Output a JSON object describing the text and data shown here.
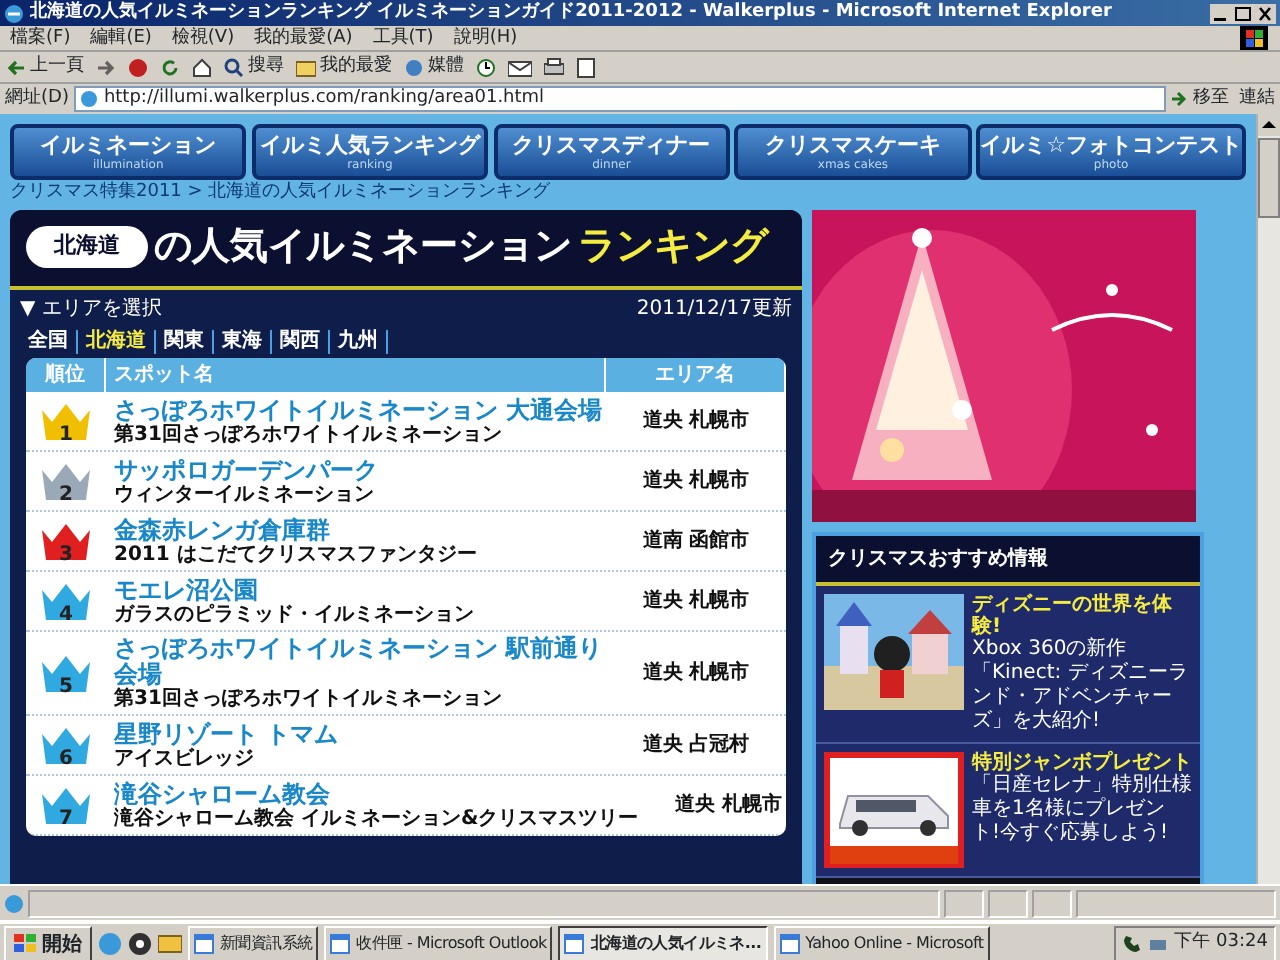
{
  "window": {
    "title": "北海道の人気イルミネーションランキング イルミネーションガイド2011-2012 - Walkerplus - Microsoft Internet Explorer"
  },
  "menu": [
    "檔案(F)",
    "編輯(E)",
    "檢視(V)",
    "我的最愛(A)",
    "工具(T)",
    "說明(H)"
  ],
  "toolbar": [
    "上一頁",
    "搜尋",
    "我的最愛",
    "媒體"
  ],
  "address": {
    "label": "網址(D)",
    "value": "http://illumi.walkerplus.com/ranking/area01.html",
    "go": "移至",
    "links": "連結"
  },
  "nav": [
    {
      "label": "イルミネーション",
      "sub": "illumination"
    },
    {
      "label": "イルミ人気ランキング",
      "sub": "ranking"
    },
    {
      "label": "クリスマスディナー",
      "sub": "dinner"
    },
    {
      "label": "クリスマスケーキ",
      "sub": "xmas cakes"
    },
    {
      "label": "イルミ☆フォトコンテスト",
      "sub": "photo"
    }
  ],
  "breadcrumb": "クリスマス特集2011 > 北海道の人気イルミネーションランキング",
  "ranking": {
    "region": "北海道",
    "title": "の人気イルミネーション",
    "title_accent": "ランキング",
    "area_label": "▼ エリアを選択",
    "updated": "2011/12/17更新",
    "areas": [
      {
        "label": "全国",
        "selected": false
      },
      {
        "label": "北海道",
        "selected": true
      },
      {
        "label": "関東",
        "selected": false
      },
      {
        "label": "東海",
        "selected": false
      },
      {
        "label": "関西",
        "selected": false
      },
      {
        "label": "九州",
        "selected": false
      }
    ],
    "columns": [
      "順位",
      "スポット名",
      "エリア名"
    ],
    "rows": [
      {
        "rank": "1",
        "color": "#f0c000",
        "name": "さっぽろホワイトイルミネーション 大通会場",
        "event": "第31回さっぽろホワイトイルミネーション",
        "area": "道央 札幌市"
      },
      {
        "rank": "2",
        "color": "#9aa8b8",
        "name": "サッポロガーデンパーク",
        "event": "ウィンターイルミネーション",
        "area": "道央 札幌市"
      },
      {
        "rank": "3",
        "color": "#e02020",
        "name": "金森赤レンガ倉庫群",
        "event": "2011 はこだてクリスマスファンタジー",
        "area": "道南 函館市"
      },
      {
        "rank": "4",
        "color": "#30a8e0",
        "name": "モエレ沼公園",
        "event": "ガラスのピラミッド・イルミネーション",
        "area": "道央 札幌市"
      },
      {
        "rank": "5",
        "color": "#30a8e0",
        "name": "さっぽろホワイトイルミネーション 駅前通り会場",
        "event": "第31回さっぽろホワイトイルミネーション",
        "area": "道央 札幌市"
      },
      {
        "rank": "6",
        "color": "#30a8e0",
        "name": "星野リゾート トマム",
        "event": "アイスビレッジ",
        "area": "道央 占冠村"
      },
      {
        "rank": "7",
        "color": "#30a8e0",
        "name": "滝谷シャローム教会",
        "event": "滝谷シャローム教会 イルミネーション&クリスマスツリー",
        "area": "道央 札幌市"
      }
    ]
  },
  "recommend": {
    "title": "クリスマスおすすめ情報",
    "items": [
      {
        "kind": "park",
        "headline": "ディズニーの世界を体験!",
        "text": "Xbox 360の新作「Kinect: ディズニーランド・アドベンチャーズ」を大紹介!"
      },
      {
        "kind": "car",
        "headline": "特別ジャンボプレゼント",
        "text": "「日産セレナ」特別仕様車を1名様にプレゼント!今すぐ応募しよう!"
      }
    ]
  },
  "taskbar": {
    "start": "開始",
    "tasks": [
      {
        "label": "新聞資訊系統",
        "selected": false
      },
      {
        "label": "收件匣 - Microsoft Outlook",
        "selected": false
      },
      {
        "label": "北海道の人気イルミネ...",
        "selected": true
      },
      {
        "label": "Yahoo Online - Microsoft",
        "selected": false
      }
    ],
    "clock": "下午 03:24"
  }
}
